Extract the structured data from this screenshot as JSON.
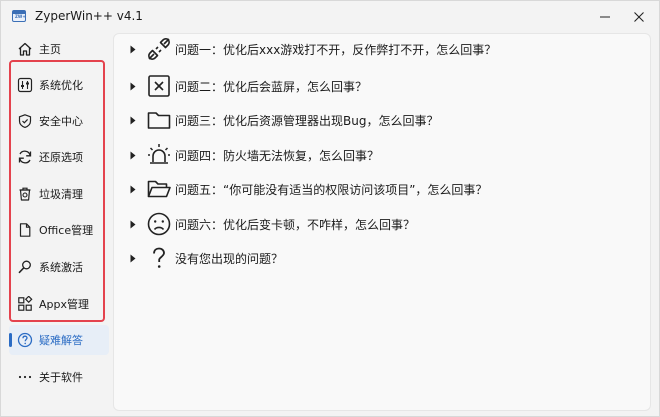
{
  "window": {
    "title": "ZyperWin++ v4.1",
    "app_icon_text": "ZW+"
  },
  "sidebar": {
    "items": [
      {
        "label": "主页",
        "icon": "home-icon"
      },
      {
        "label": "系统优化",
        "icon": "sliders-icon"
      },
      {
        "label": "安全中心",
        "icon": "shield-icon"
      },
      {
        "label": "还原选项",
        "icon": "refresh-icon"
      },
      {
        "label": "垃圾清理",
        "icon": "trash-icon"
      },
      {
        "label": "Office管理",
        "icon": "document-icon"
      },
      {
        "label": "系统激活",
        "icon": "key-icon"
      },
      {
        "label": "Appx管理",
        "icon": "apps-grid-icon"
      },
      {
        "label": "疑难解答",
        "icon": "help-circle-icon"
      },
      {
        "label": "关于软件",
        "icon": "more-icon"
      }
    ],
    "active_index": 8
  },
  "faq": {
    "items": [
      {
        "label": "问题一：优化后xxx游戏打不开，反作弊打不开，怎么回事？",
        "icon": "unplugged-icon"
      },
      {
        "label": "问题二：优化后会蓝屏，怎么回事？",
        "icon": "close-box-icon"
      },
      {
        "label": "问题三：优化后资源管理器出现Bug，怎么回事？",
        "icon": "folder-icon"
      },
      {
        "label": "问题四：防火墙无法恢复，怎么回事？",
        "icon": "alarm-light-icon"
      },
      {
        "label": "问题五：“你可能没有适当的权限访问该项目”，怎么回事？",
        "icon": "folder-open-icon"
      },
      {
        "label": "问题六：优化后变卡顿，不咋样，怎么回事？",
        "icon": "sad-face-icon"
      },
      {
        "label": "没有您出现的问题？",
        "icon": "question-mark-icon"
      }
    ]
  },
  "colors": {
    "accent": "#2b6cc4",
    "highlight_border": "#e4424d"
  }
}
